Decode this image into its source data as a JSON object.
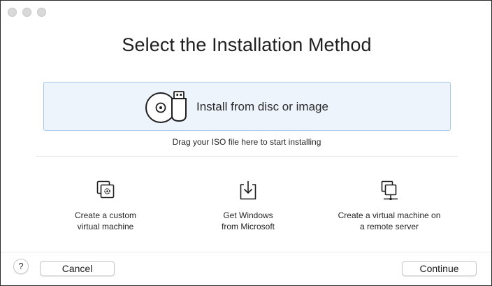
{
  "window": {
    "controls": [
      "close",
      "minimize",
      "zoom"
    ]
  },
  "title": "Select the Installation Method",
  "dropzone": {
    "icon": "disc-usb-icon",
    "label": "Install from disc or image"
  },
  "drag_hint": "Drag your ISO file here to start installing",
  "options": [
    {
      "icon": "custom-vm-icon",
      "label": "Create a custom\nvirtual machine"
    },
    {
      "icon": "download-icon",
      "label": "Get Windows\nfrom Microsoft"
    },
    {
      "icon": "remote-server-icon",
      "label": "Create a virtual machine on\na remote server"
    }
  ],
  "footer": {
    "help": "?",
    "cancel": "Cancel",
    "continue": "Continue"
  }
}
